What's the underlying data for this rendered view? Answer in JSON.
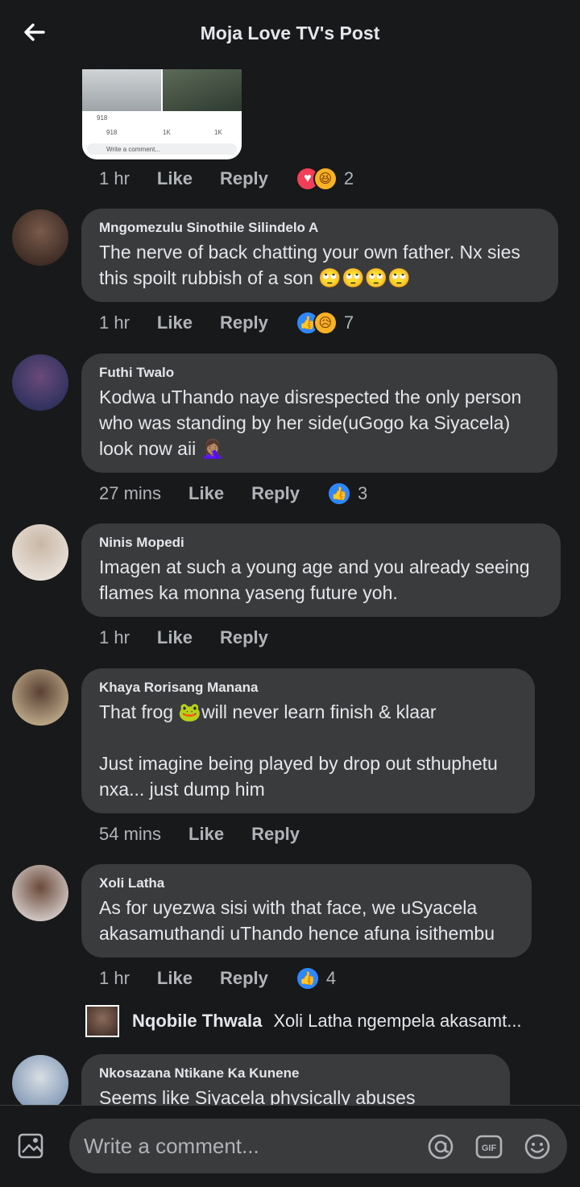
{
  "header": {
    "title": "Moja Love TV's Post"
  },
  "attachment": {
    "reactions": "918",
    "likes": "918",
    "comments": "1K",
    "shares": "1K",
    "write": "Write a comment..."
  },
  "top_meta": {
    "time": "1 hr",
    "like": "Like",
    "reply": "Reply",
    "count": "2"
  },
  "comments": [
    {
      "name": "Mngomezulu Sinothile Silindelo A",
      "text": "The nerve of back chatting your own father. Nx sies\nthis spoilt rubbish of a son 🙄🙄🙄🙄",
      "time": "1 hr",
      "like": "Like",
      "reply": "Reply",
      "count": "7"
    },
    {
      "name": "Futhi Twalo",
      "text": "Kodwa uThando naye disrespected the only person\nwho was standing by her side(uGogo ka Siyacela)\nlook now aii 🤦🏽‍♀️",
      "time": "27 mins",
      "like": "Like",
      "reply": "Reply",
      "count": "3"
    },
    {
      "name": "Ninis Mopedi",
      "text": "Imagen at such a young age and you already seeing\nflames ka monna yaseng future yoh.",
      "time": "1 hr",
      "like": "Like",
      "reply": "Reply"
    },
    {
      "name": "Khaya Rorisang Manana",
      "text": "That frog 🐸will never learn finish & klaar\n\nJust imagine being played by drop out sthuphetu\nnxa... just dump him",
      "time": "54 mins",
      "like": "Like",
      "reply": "Reply"
    },
    {
      "name": "Xoli Latha",
      "text": "As for uyezwa sisi with that face, we uSyacela\nakasamuthandi uThando hence afuna isithembu",
      "time": "1 hr",
      "like": "Like",
      "reply": "Reply",
      "count": "4"
    },
    {
      "name": "Nkosazana Ntikane Ka Kunene",
      "text": "Seems like Siyacela physically abuses"
    }
  ],
  "reply_preview": {
    "name": "Nqobile Thwala",
    "text": "Xoli Latha ngempela akasamt..."
  },
  "composer": {
    "placeholder": "Write a comment...",
    "gif": "GIF"
  },
  "colors": {
    "background": "#18191a",
    "bubble": "#3a3b3c",
    "like_blue": "#2d88ff",
    "love_red": "#f33e58",
    "haha_yellow": "#f7b125"
  }
}
